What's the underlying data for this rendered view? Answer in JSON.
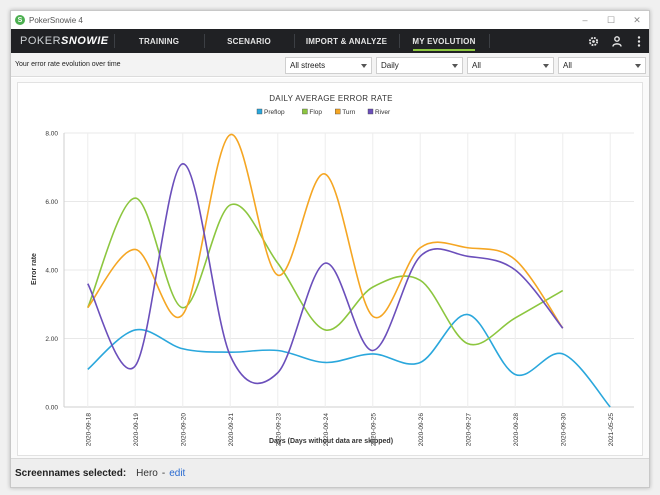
{
  "window": {
    "title": "PokerSnowie 4",
    "controls": {
      "minimize": "–",
      "maximize": "☐",
      "close": "✕"
    }
  },
  "nav": {
    "logo_prefix": "POKER",
    "logo_brand": "SNOWIE",
    "items": [
      {
        "label": "TRAINING"
      },
      {
        "label": "SCENARIO"
      },
      {
        "label": "IMPORT & ANALYZE"
      },
      {
        "label": "MY EVOLUTION",
        "active": true
      }
    ],
    "icons": [
      "gear-icon",
      "user-icon",
      "more-vertical-icon"
    ]
  },
  "filters": {
    "caption": "Your error rate evolution over time",
    "dropdowns": [
      {
        "value": "All streets"
      },
      {
        "value": "Daily"
      },
      {
        "value": "All"
      },
      {
        "value": "All"
      }
    ]
  },
  "chart_data": {
    "type": "line",
    "title": "DAILY AVERAGE ERROR RATE",
    "xlabel": "Days (Days without data are skipped)",
    "ylabel": "Error rate",
    "ylim": [
      0,
      8
    ],
    "yticks": [
      "0.00",
      "2.00",
      "4.00",
      "6.00",
      "8.00"
    ],
    "legend_position": "top",
    "grid": true,
    "smooth": true,
    "categories": [
      "2020-09-18",
      "2020-09-19",
      "2020-09-20",
      "2020-09-21",
      "2020-09-23",
      "2020-09-24",
      "2020-09-25",
      "2020-09-26",
      "2020-09-27",
      "2020-09-28",
      "2020-09-30",
      "2021-05-25"
    ],
    "series": [
      {
        "name": "Preflop",
        "color": "#2aa7dc",
        "values": [
          1.1,
          2.25,
          1.7,
          1.6,
          1.65,
          1.3,
          1.55,
          1.3,
          2.7,
          0.95,
          1.55,
          0.0
        ]
      },
      {
        "name": "Flop",
        "color": "#8cc63f",
        "values": [
          2.9,
          6.1,
          2.9,
          5.9,
          4.2,
          2.25,
          3.5,
          3.7,
          1.85,
          2.6,
          3.4,
          null
        ]
      },
      {
        "name": "Turn",
        "color": "#f5a623",
        "values": [
          2.9,
          4.6,
          2.7,
          7.95,
          3.85,
          6.8,
          2.65,
          4.65,
          4.65,
          4.3,
          2.3,
          null
        ]
      },
      {
        "name": "River",
        "color": "#6b4fbb",
        "values": [
          3.6,
          1.2,
          7.1,
          1.5,
          1.0,
          4.2,
          1.65,
          4.4,
          4.4,
          4.0,
          2.3,
          null
        ]
      }
    ]
  },
  "footer": {
    "label": "Screennames selected:",
    "value": "Hero",
    "separator": "-",
    "edit_label": "edit"
  }
}
